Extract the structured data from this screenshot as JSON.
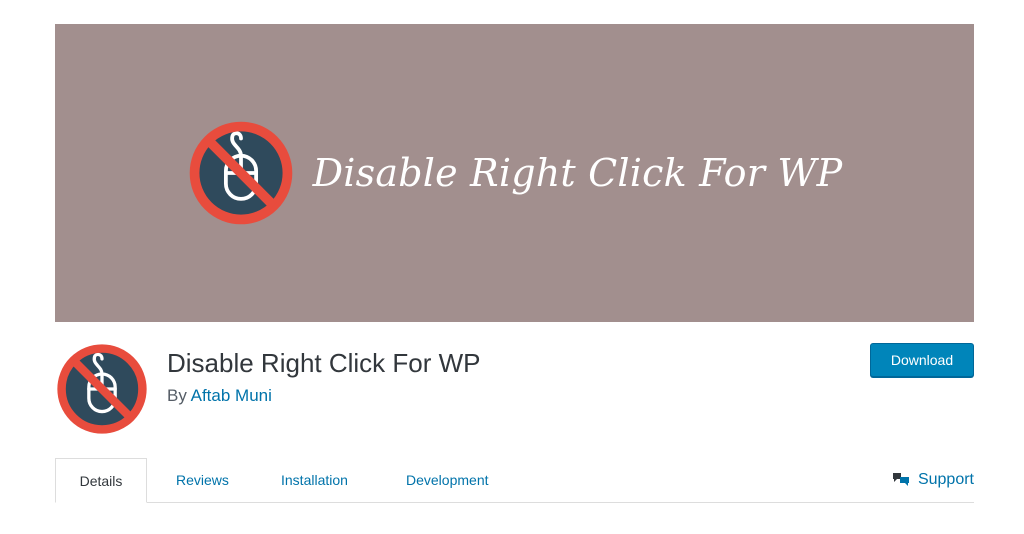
{
  "colors": {
    "banner_bg": "#a28f8e",
    "accent": "#0073aa",
    "button_bg": "#0085ba",
    "logo_ring": "#e84c3d",
    "logo_fill": "#2f4a5c"
  },
  "banner": {
    "title": "Disable Right Click For WP",
    "logo_icon": "no-mouse-icon"
  },
  "plugin": {
    "title": "Disable Right Click For WP",
    "by_prefix": "By ",
    "author": "Aftab Muni",
    "icon": "no-mouse-icon"
  },
  "actions": {
    "download_label": "Download"
  },
  "tabs": [
    {
      "label": "Details",
      "active": true
    },
    {
      "label": "Reviews",
      "active": false
    },
    {
      "label": "Installation",
      "active": false
    },
    {
      "label": "Development",
      "active": false
    }
  ],
  "support": {
    "label": "Support",
    "icon": "speech-bubbles-icon"
  }
}
